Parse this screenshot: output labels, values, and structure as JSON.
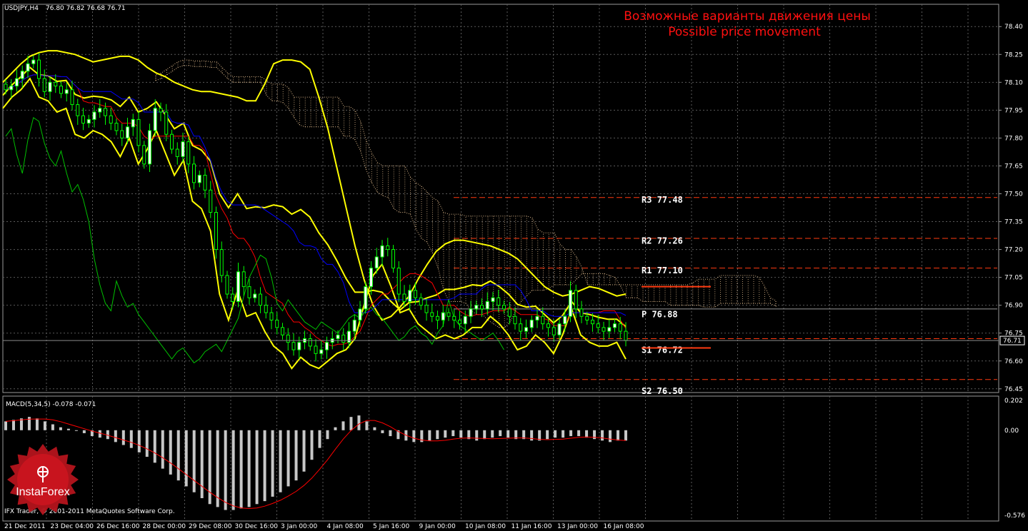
{
  "header": {
    "symbol": "USDJPY,H4",
    "ohlc": "76.80 76.82 76.68 76.71"
  },
  "title": {
    "ru": "Возможные варианты движения цены",
    "en": "Possible price movement"
  },
  "macd_label": "MACD(5,34,5) -0.078 -0.071",
  "copyright": "IFX Trader, © 2001-2011 MetaQuotes Software Corp.",
  "brand": "InstaForex",
  "colors": {
    "background": "#000000",
    "grid": "#5a5a5a",
    "bollinger": "#ffff00",
    "tenkan": "#ff0000",
    "kijun": "#0000ff",
    "chikou": "#00c000",
    "cloud": "#ffd5a0",
    "level_line": "#ff3a10",
    "macd_hist": "#c8c8c8",
    "macd_signal": "#ff0000",
    "bull": "#ffffff",
    "bear": "#00ff00"
  },
  "chart_data": {
    "type": "candlestick",
    "price_axis": {
      "ticks": [
        "78.40",
        "78.25",
        "78.10",
        "77.95",
        "77.80",
        "77.65",
        "77.50",
        "77.35",
        "77.20",
        "77.05",
        "76.90",
        "76.75",
        "76.60",
        "76.45"
      ],
      "current": "76.71",
      "ylim": [
        76.43,
        78.52
      ]
    },
    "time_axis": [
      "21 Dec 2011",
      "23 Dec 04:00",
      "26 Dec 16:00",
      "28 Dec 00:00",
      "29 Dec 08:00",
      "30 Dec 16:00",
      "3 Jan 00:00",
      "4 Jan 08:00",
      "5 Jan 16:00",
      "9 Jan 00:00",
      "10 Jan 08:00",
      "11 Jan 16:00",
      "13 Jan 00:00",
      "16 Jan 08:00"
    ],
    "levels": [
      {
        "name": "R3 77.48",
        "value": 77.48,
        "style": "dashed"
      },
      {
        "name": "R2 77.26",
        "value": 77.26,
        "style": "dashed"
      },
      {
        "name": "R1 77.10",
        "value": 77.1,
        "style": "dashed"
      },
      {
        "name": "P 76.88",
        "value": 76.88,
        "style": "solid"
      },
      {
        "name": "S1 76.72",
        "value": 76.72,
        "style": "dashed"
      },
      {
        "name": "S2 76.50",
        "value": 76.5,
        "style": "dashed"
      }
    ],
    "marked_levels": [
      77.0,
      76.67
    ],
    "close": [
      78.06,
      78.08,
      78.12,
      78.16,
      78.2,
      78.22,
      78.12,
      78.05,
      78.1,
      78.08,
      78.04,
      78.06,
      77.98,
      77.92,
      77.88,
      77.9,
      77.94,
      77.96,
      77.92,
      77.88,
      77.84,
      77.8,
      77.86,
      77.9,
      77.76,
      77.66,
      77.84,
      77.96,
      77.94,
      77.82,
      77.74,
      77.7,
      77.78,
      77.66,
      77.56,
      77.6,
      77.52,
      77.4,
      77.2,
      77.06,
      76.96,
      76.92,
      77.08,
      77.0,
      76.94,
      76.96,
      76.9,
      76.86,
      76.82,
      76.78,
      76.74,
      76.7,
      76.66,
      76.7,
      76.72,
      76.68,
      76.64,
      76.66,
      76.7,
      76.72,
      76.74,
      76.7,
      76.76,
      76.82,
      76.88,
      77.0,
      77.1,
      77.16,
      77.22,
      77.2,
      77.1,
      76.96,
      76.92,
      76.98,
      76.94,
      76.9,
      76.86,
      76.84,
      76.82,
      76.86,
      76.84,
      76.82,
      76.8,
      76.84,
      76.88,
      76.9,
      76.88,
      76.92,
      76.94,
      76.9,
      76.88,
      76.84,
      76.8,
      76.76,
      76.78,
      76.82,
      76.84,
      76.8,
      76.78,
      76.74,
      76.8,
      76.84,
      76.98,
      76.88,
      76.84,
      76.82,
      76.8,
      76.78,
      76.76,
      76.78,
      76.8,
      76.76,
      76.71
    ],
    "bollinger_upper": [
      78.1,
      78.15,
      78.2,
      78.24,
      78.26,
      78.27,
      78.27,
      78.26,
      78.25,
      78.23,
      78.21,
      78.22,
      78.23,
      78.24,
      78.24,
      78.22,
      78.18,
      78.15,
      78.13,
      78.1,
      78.08,
      78.06,
      78.05,
      78.05,
      78.04,
      78.03,
      78.02,
      78.0,
      78.0,
      78.09,
      78.2,
      78.22,
      78.22,
      78.21,
      78.17,
      78.02,
      77.85,
      77.64,
      77.43,
      77.22,
      77.04,
      76.9,
      76.82,
      76.84,
      76.89,
      76.95,
      77.04,
      77.12,
      77.19,
      77.23,
      77.25,
      77.25,
      77.24,
      77.23,
      77.22,
      77.2,
      77.18,
      77.15,
      77.1,
      77.05,
      77.0,
      76.97,
      76.95,
      76.96,
      76.98,
      77.0,
      76.99,
      76.97,
      76.95,
      76.96
    ],
    "macd_hist": [
      0.06,
      0.07,
      0.08,
      0.09,
      0.08,
      0.06,
      0.04,
      0.02,
      0.01,
      0.0,
      -0.02,
      -0.04,
      -0.05,
      -0.06,
      -0.08,
      -0.1,
      -0.12,
      -0.15,
      -0.18,
      -0.22,
      -0.26,
      -0.3,
      -0.34,
      -0.38,
      -0.42,
      -0.46,
      -0.5,
      -0.52,
      -0.54,
      -0.54,
      -0.53,
      -0.52,
      -0.5,
      -0.48,
      -0.45,
      -0.42,
      -0.38,
      -0.34,
      -0.28,
      -0.2,
      -0.12,
      -0.06,
      0.02,
      0.06,
      0.09,
      0.1,
      0.06,
      0.02,
      -0.02,
      -0.04,
      -0.06,
      -0.07,
      -0.08,
      -0.08,
      -0.07,
      -0.06,
      -0.05,
      -0.04,
      -0.05,
      -0.06,
      -0.07,
      -0.06,
      -0.05,
      -0.04,
      -0.05,
      -0.06,
      -0.06,
      -0.07,
      -0.07,
      -0.06,
      -0.05,
      -0.05,
      -0.04,
      -0.04,
      -0.05,
      -0.06,
      -0.07,
      -0.08,
      -0.07,
      -0.07
    ],
    "macd_axis": {
      "top": "0.202",
      "zero": "0.00",
      "bottom": "-0.576",
      "ylim": [
        -0.576,
        0.202
      ]
    }
  }
}
